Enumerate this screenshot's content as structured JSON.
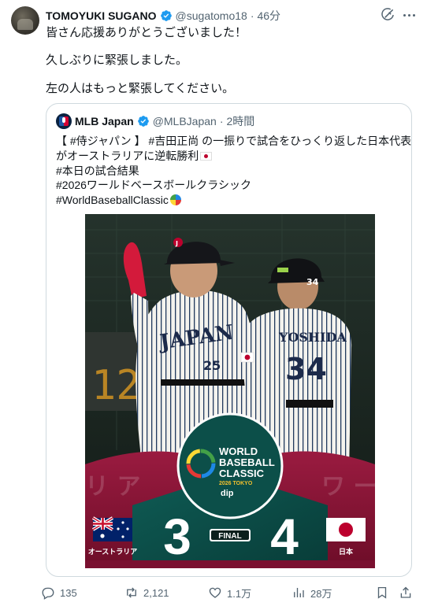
{
  "post": {
    "author_name": "TOMOYUKI SUGANO",
    "handle": "@sugatomo18",
    "separator": "·",
    "time": "46分",
    "lines": [
      "皆さん応援ありがとうございました！",
      "久しぶりに緊張しました。",
      "左の人はもっと緊張してください。"
    ]
  },
  "quote": {
    "author_name": "MLB Japan",
    "handle": "@MLBJapan",
    "separator": "·",
    "time": "2時間",
    "lines": [
      "【 #侍ジャパン 】 #吉田正尚 の一振りで試合をひっくり返した日本代表",
      "がオーストラリアに逆転勝利",
      "#本日の試合結果",
      "#2026ワールドベースボールクラシック",
      "#WorldBaseballClassic"
    ]
  },
  "photo": {
    "jersey_left": "JAPAN",
    "number_left": "25",
    "jersey_right_name": "YOSHIDA",
    "number_right": "34",
    "helmet_number": "34",
    "logo_line1": "WORLD",
    "logo_line2": "BASEBALL",
    "logo_line3": "CLASSIC",
    "logo_line4": "2026 TOKYO",
    "logo_sponsor": "dip",
    "scoreboard_digits": "12",
    "team_left": "オーストラリア",
    "score_left": "3",
    "status": "FINAL",
    "score_right": "4",
    "team_right": "日本",
    "colors": {
      "maroon": "#8f1436",
      "teal": "#0b4f4a",
      "crimson": "#c0163d"
    }
  },
  "actions": {
    "replies": "135",
    "reposts": "2,121",
    "likes": "1.1万",
    "views": "28万"
  },
  "icons": [
    "grok-icon",
    "more-icon",
    "verified-icon",
    "reply-icon",
    "repost-icon",
    "like-icon",
    "views-icon",
    "bookmark-icon",
    "share-icon"
  ]
}
